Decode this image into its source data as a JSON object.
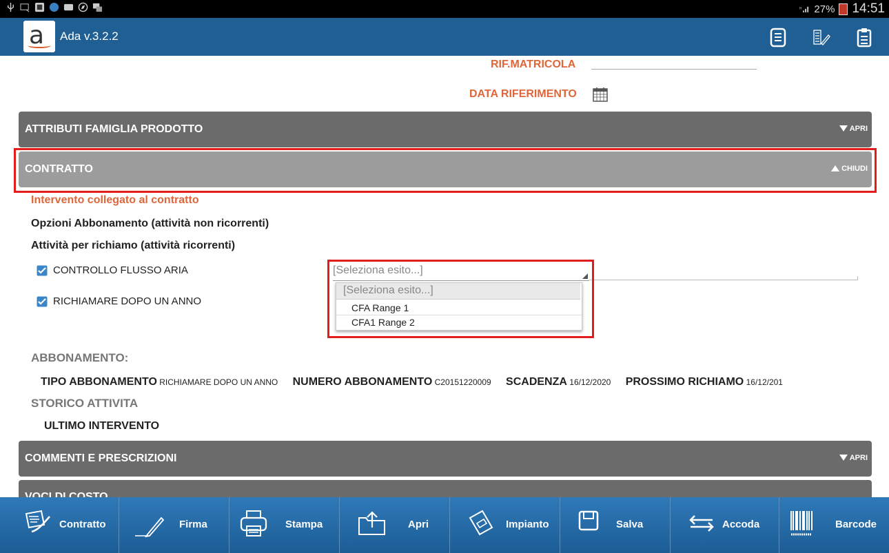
{
  "statusbar": {
    "battery": "27%",
    "time": "14:51"
  },
  "app": {
    "title": "Ada v.3.2.2",
    "logo_letter": "a"
  },
  "fields": {
    "matricola_label": "RIF.MATRICOLA",
    "data_label": "DATA RIFERIMENTO"
  },
  "sections": {
    "attributi": {
      "title": "ATTRIBUTI FAMIGLIA PRODOTTO",
      "toggle": "APRI"
    },
    "contratto": {
      "title": "CONTRATTO",
      "toggle": "CHIUDI"
    },
    "commenti": {
      "title": "COMMENTI E PRESCRIZIONI",
      "toggle": "APRI"
    },
    "voci": {
      "title": "VOCI DI COSTO"
    }
  },
  "contratto": {
    "intervento": "Intervento collegato al contratto",
    "opzioni": "Opzioni Abbonamento (attività non ricorrenti)",
    "attivita": "Attività per richiamo (attività ricorrenti)",
    "checks": [
      {
        "label": "CONTROLLO FLUSSO ARIA",
        "checked": true
      },
      {
        "label": "RICHIAMARE DOPO UN ANNO",
        "checked": true
      }
    ],
    "select": {
      "placeholder": "[Seleziona esito...]",
      "options": [
        "[Seleziona esito...]",
        "CFA Range 1",
        "CFA1 Range 2"
      ]
    }
  },
  "abbonamento": {
    "heading": "ABBONAMENTO:",
    "tipo_label": "TIPO ABBONAMENTO",
    "tipo_value": "RICHIAMARE DOPO UN ANNO",
    "numero_label": "NUMERO ABBONAMENTO",
    "numero_value": "C20151220009",
    "scadenza_label": "SCADENZA",
    "scadenza_value": "16/12/2020",
    "prossimo_label": "PROSSIMO RICHIAMO",
    "prossimo_value": "16/12/201"
  },
  "storico": {
    "heading": "STORICO ATTIVITA",
    "ultimo": "ULTIMO INTERVENTO"
  },
  "bottombar": {
    "buttons": [
      "Contratto",
      "Firma",
      "Stampa",
      "Apri",
      "Impianto",
      "Salva",
      "Accoda",
      "Barcode"
    ]
  },
  "colors": {
    "appbar": "#1f5f93",
    "accent": "#e0663a",
    "highlight": "#e21b1b"
  }
}
